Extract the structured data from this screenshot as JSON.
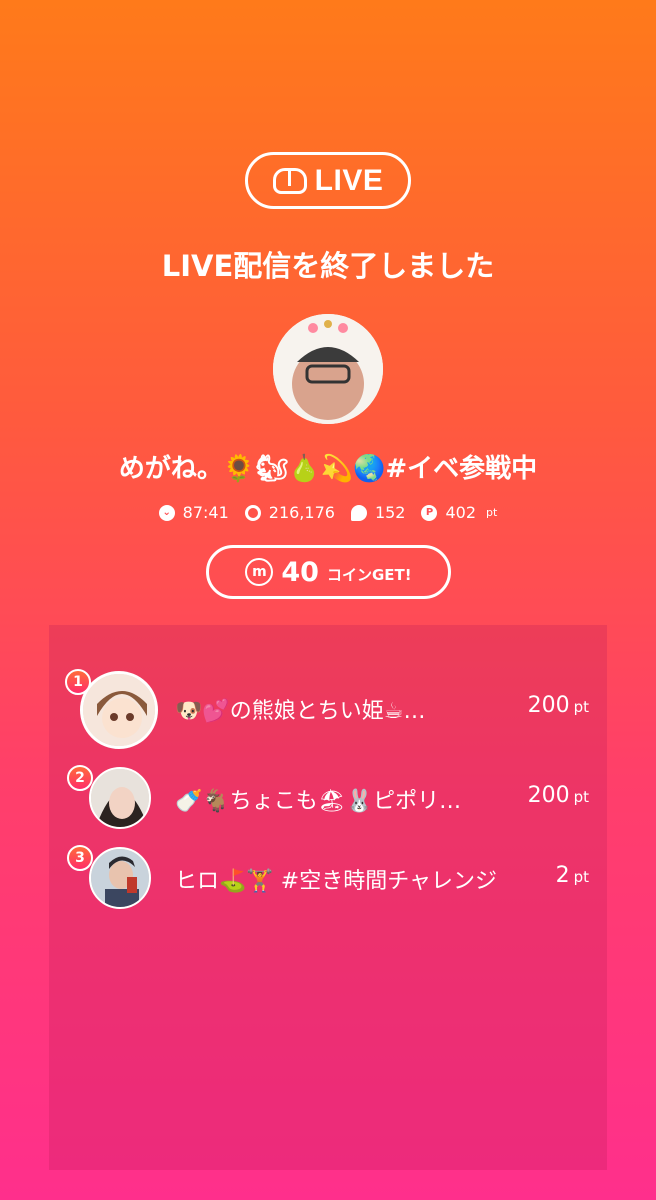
{
  "logo": {
    "text": "LIVE"
  },
  "title": "LIVE配信を終了しました",
  "host": {
    "name": "めがね。🌻🐿🍐💫🌏#イベ参戦中",
    "avatar_alt": "host-avatar"
  },
  "stats": {
    "duration": "87:41",
    "viewers": "216,176",
    "comments": "152",
    "points": "402",
    "points_unit": "pt"
  },
  "coin": {
    "icon": "m",
    "amount": "40",
    "label": "コインGET!"
  },
  "ranking": [
    {
      "rank": "1",
      "name": "🐶💕の熊娘とちい姫☕…",
      "score": "200",
      "unit": "pt"
    },
    {
      "rank": "2",
      "name": "🍼🐐ちょこも🏖🐰ピポリ…",
      "score": "200",
      "unit": "pt"
    },
    {
      "rank": "3",
      "name": "ヒロ⛳🏋 #空き時間チャレンジ",
      "score": "2",
      "unit": "pt"
    }
  ],
  "colors": {
    "gradient_top": "#ff7a1a",
    "gradient_bottom": "#ff2f8c"
  }
}
